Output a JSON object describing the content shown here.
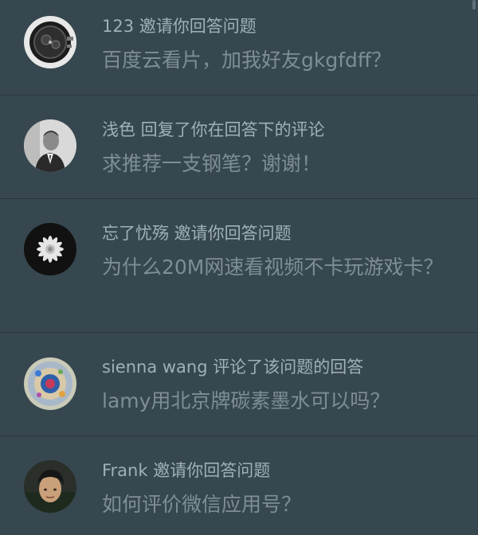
{
  "notifications": [
    {
      "actor": "123 邀请你回答问题",
      "question": "百度云看片，加我好友gkgfdff？",
      "avatar_icon": "watch-avatar"
    },
    {
      "actor": "浅色 回复了你在回答下的评论",
      "question": "求推荐一支钢笔？谢谢！",
      "avatar_icon": "man-in-suit-avatar"
    },
    {
      "actor": "忘了忧殇 邀请你回答问题",
      "question": "为什么20M网速看视频不卡玩游戏卡？",
      "avatar_icon": "white-flower-avatar"
    },
    {
      "actor": "sienna wang 评论了该问题的回答",
      "question": "lamy用北京牌碳素墨水可以吗？",
      "avatar_icon": "colorful-pattern-avatar"
    },
    {
      "actor": "Frank 邀请你回答问题",
      "question": "如何评价微信应用号？",
      "avatar_icon": "young-man-avatar"
    }
  ],
  "colors": {
    "background": "#37474f",
    "divider": "#2b383f",
    "actor_text": "#9fb0b8",
    "question_text": "#7e8e97"
  }
}
